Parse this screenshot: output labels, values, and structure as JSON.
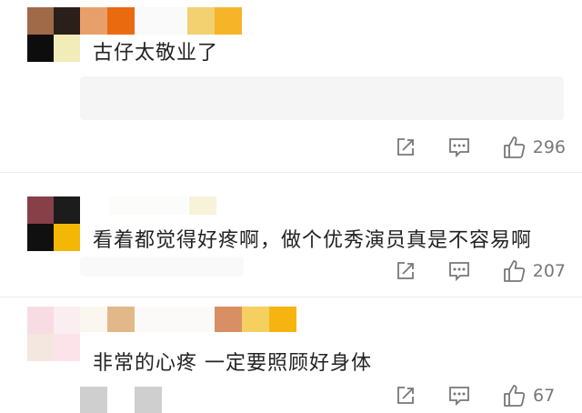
{
  "colors": {
    "text": "#222222",
    "meta": "#777777",
    "divider": "#ededed",
    "mosaic_1": [
      "#a06a48",
      "#2a1f1a",
      "#e8a06a",
      "#ea6a10",
      "#f3d070",
      "#f6b428",
      "#0d0d0d",
      "#f2ecb8"
    ],
    "mosaic_2": [
      "#884048",
      "#1c1c1c",
      "#101010",
      "#f5b705",
      "#f6f3d8"
    ],
    "mosaic_3": [
      "#f7dde3",
      "#f4e7e0",
      "#fbe3e9",
      "#e2b88a",
      "#d98f64",
      "#f3d060",
      "#f6b410",
      "#cfcfcf"
    ]
  },
  "comments": [
    {
      "text": "古仔太敬业了",
      "like_count": "296",
      "icons": [
        "share-icon",
        "reply-icon",
        "thumbs-up-icon"
      ]
    },
    {
      "text": "看着都觉得好疼啊，做个优秀演员真是不容易啊",
      "like_count": "207",
      "icons": [
        "share-icon",
        "reply-icon",
        "thumbs-up-icon"
      ]
    },
    {
      "text": "非常的心疼 一定要照顾好身体",
      "like_count": "67",
      "icons": [
        "share-icon",
        "reply-icon",
        "thumbs-up-icon"
      ]
    }
  ]
}
